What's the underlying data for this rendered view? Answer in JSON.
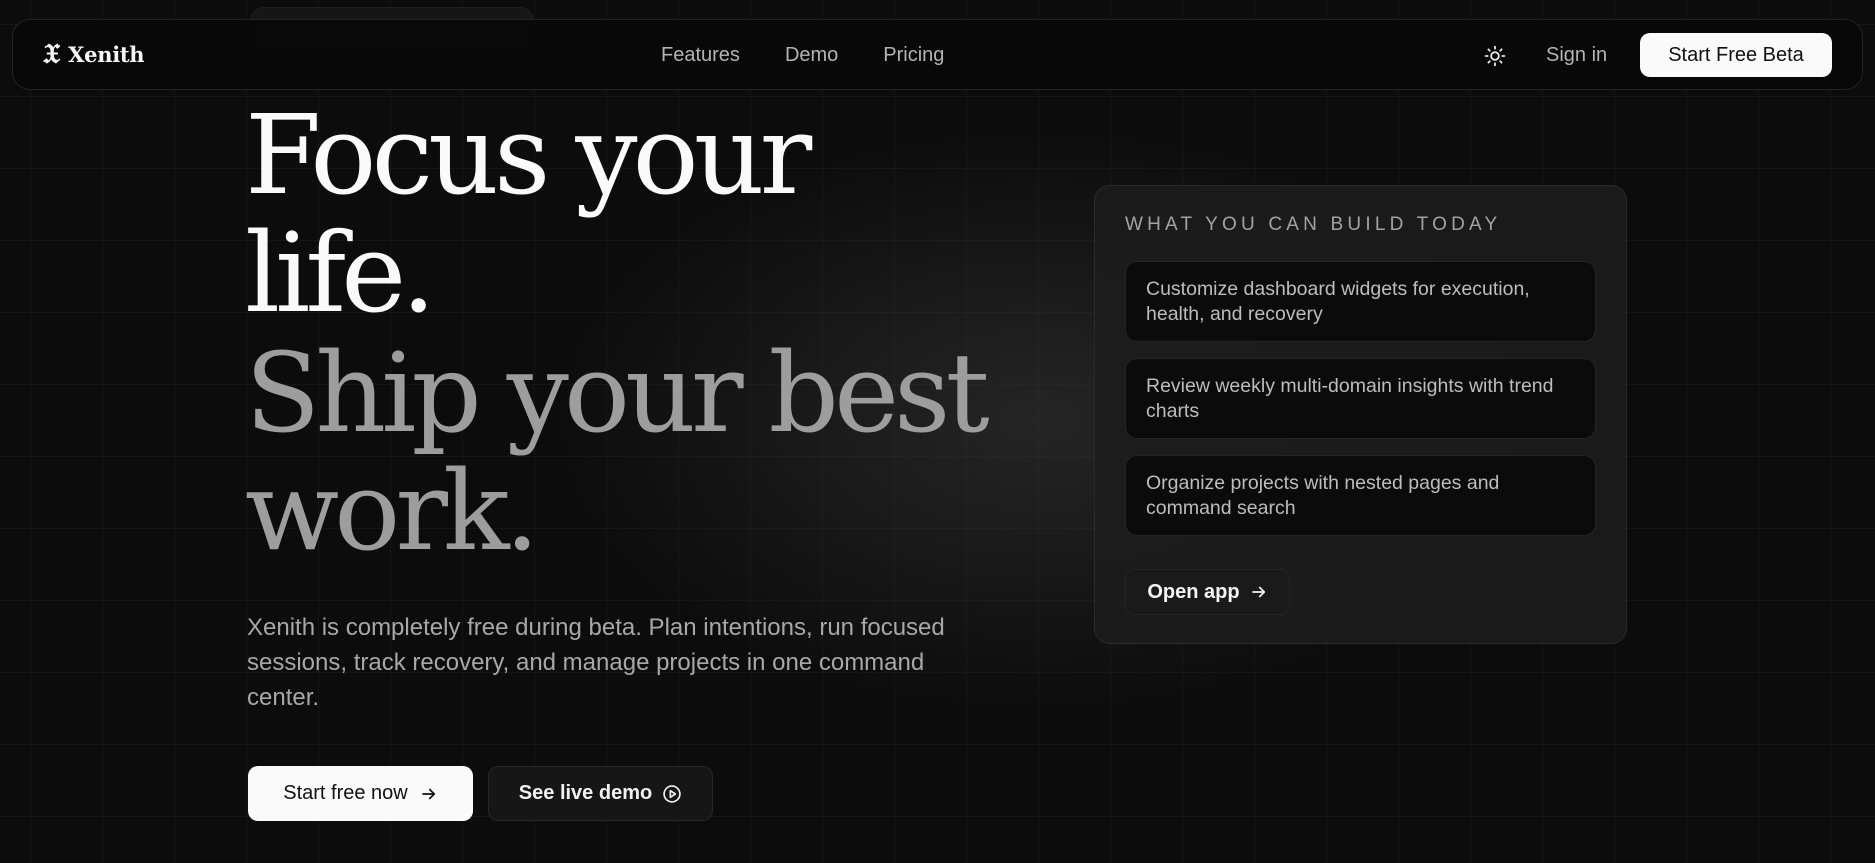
{
  "brand": {
    "logo_glyph": "𝔛",
    "name": "Xenith"
  },
  "nav": {
    "links": [
      "Features",
      "Demo",
      "Pricing"
    ],
    "theme_toggle_icon": "sun-icon",
    "sign_in": "Sign in",
    "cta": "Start Free Beta"
  },
  "hero": {
    "line1": "Focus your",
    "line2": "life.",
    "line3": "Ship your best",
    "line4": "work.",
    "description": "Xenith is completely free during beta. Plan intentions, run focused sessions, track recovery, and manage projects in one command center.",
    "primary_cta": "Start free now",
    "primary_cta_icon": "arrow-right-icon",
    "secondary_cta": "See live demo",
    "secondary_cta_icon": "play-circle-icon"
  },
  "card": {
    "title": "WHAT YOU CAN BUILD TODAY",
    "features": [
      "Customize dashboard widgets for execution, health, and recovery",
      "Review weekly multi-domain insights with trend charts",
      "Organize projects with nested pages and command search"
    ],
    "open_app": "Open app",
    "open_app_icon": "arrow-right-icon"
  },
  "colors": {
    "background": "#0c0c0c",
    "primary_button": "#fafafa",
    "hero_white": "#fafafa",
    "hero_grey": "#9d9d9d"
  }
}
